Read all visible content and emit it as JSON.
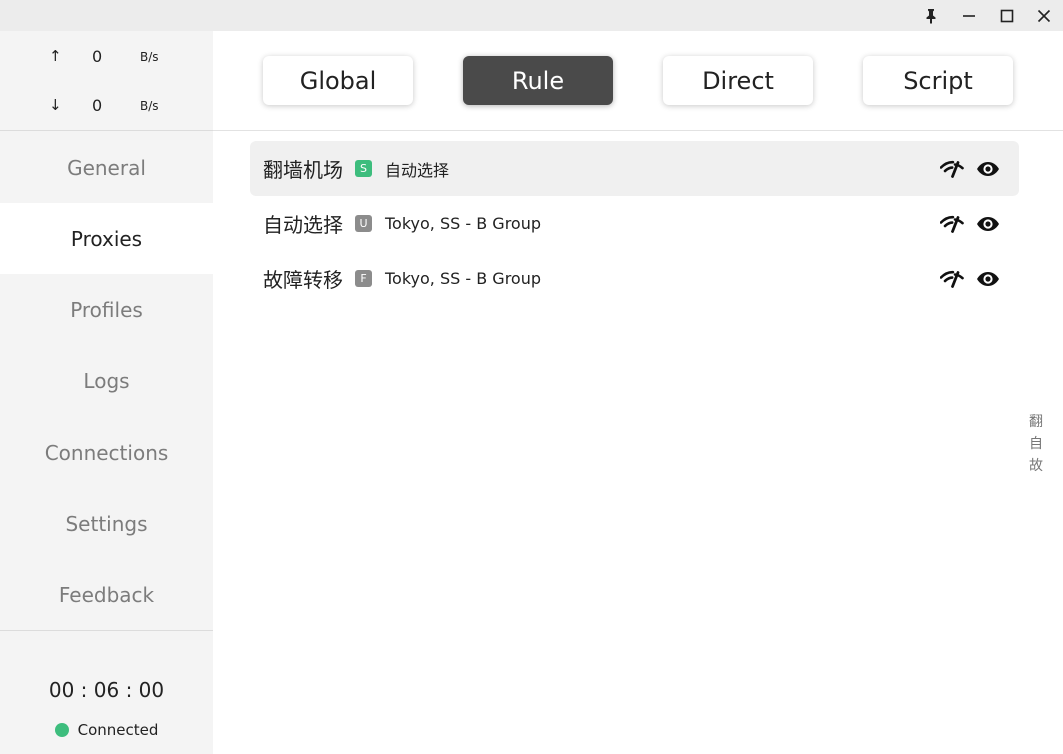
{
  "window": {
    "buttons": {
      "pin": "pin-icon",
      "minimize": "minimize-icon",
      "maximize": "maximize-icon",
      "close": "close-icon"
    }
  },
  "traffic": {
    "up": {
      "arrow": "↑",
      "value": "0",
      "unit": "B/s"
    },
    "down": {
      "arrow": "↓",
      "value": "0",
      "unit": "B/s"
    }
  },
  "sidebar": {
    "items": [
      {
        "label": "General"
      },
      {
        "label": "Proxies"
      },
      {
        "label": "Profiles"
      },
      {
        "label": "Logs"
      },
      {
        "label": "Connections"
      },
      {
        "label": "Settings"
      },
      {
        "label": "Feedback"
      }
    ],
    "active": "Proxies",
    "timer": "00 : 06 : 00",
    "status": "Connected",
    "status_color": "#3dbd7d"
  },
  "modes": {
    "items": [
      {
        "label": "Global"
      },
      {
        "label": "Rule"
      },
      {
        "label": "Direct"
      },
      {
        "label": "Script"
      }
    ],
    "active": "Rule"
  },
  "groups": [
    {
      "name": "翻墙机场",
      "type": "S",
      "type_color": "#3dbd7d",
      "now": "自动选择"
    },
    {
      "name": "自动选择",
      "type": "U",
      "type_color": "#8c8c8c",
      "now": "Tokyo, SS - B Group"
    },
    {
      "name": "故障转移",
      "type": "F",
      "type_color": "#8c8c8c",
      "now": "Tokyo, SS - B Group"
    }
  ],
  "index_bar": [
    "翻",
    "自",
    "故"
  ],
  "colors": {
    "accent_dark": "#4a4a4a",
    "sidebar_bg": "#f4f4f4",
    "titlebar_bg": "#ececec"
  }
}
